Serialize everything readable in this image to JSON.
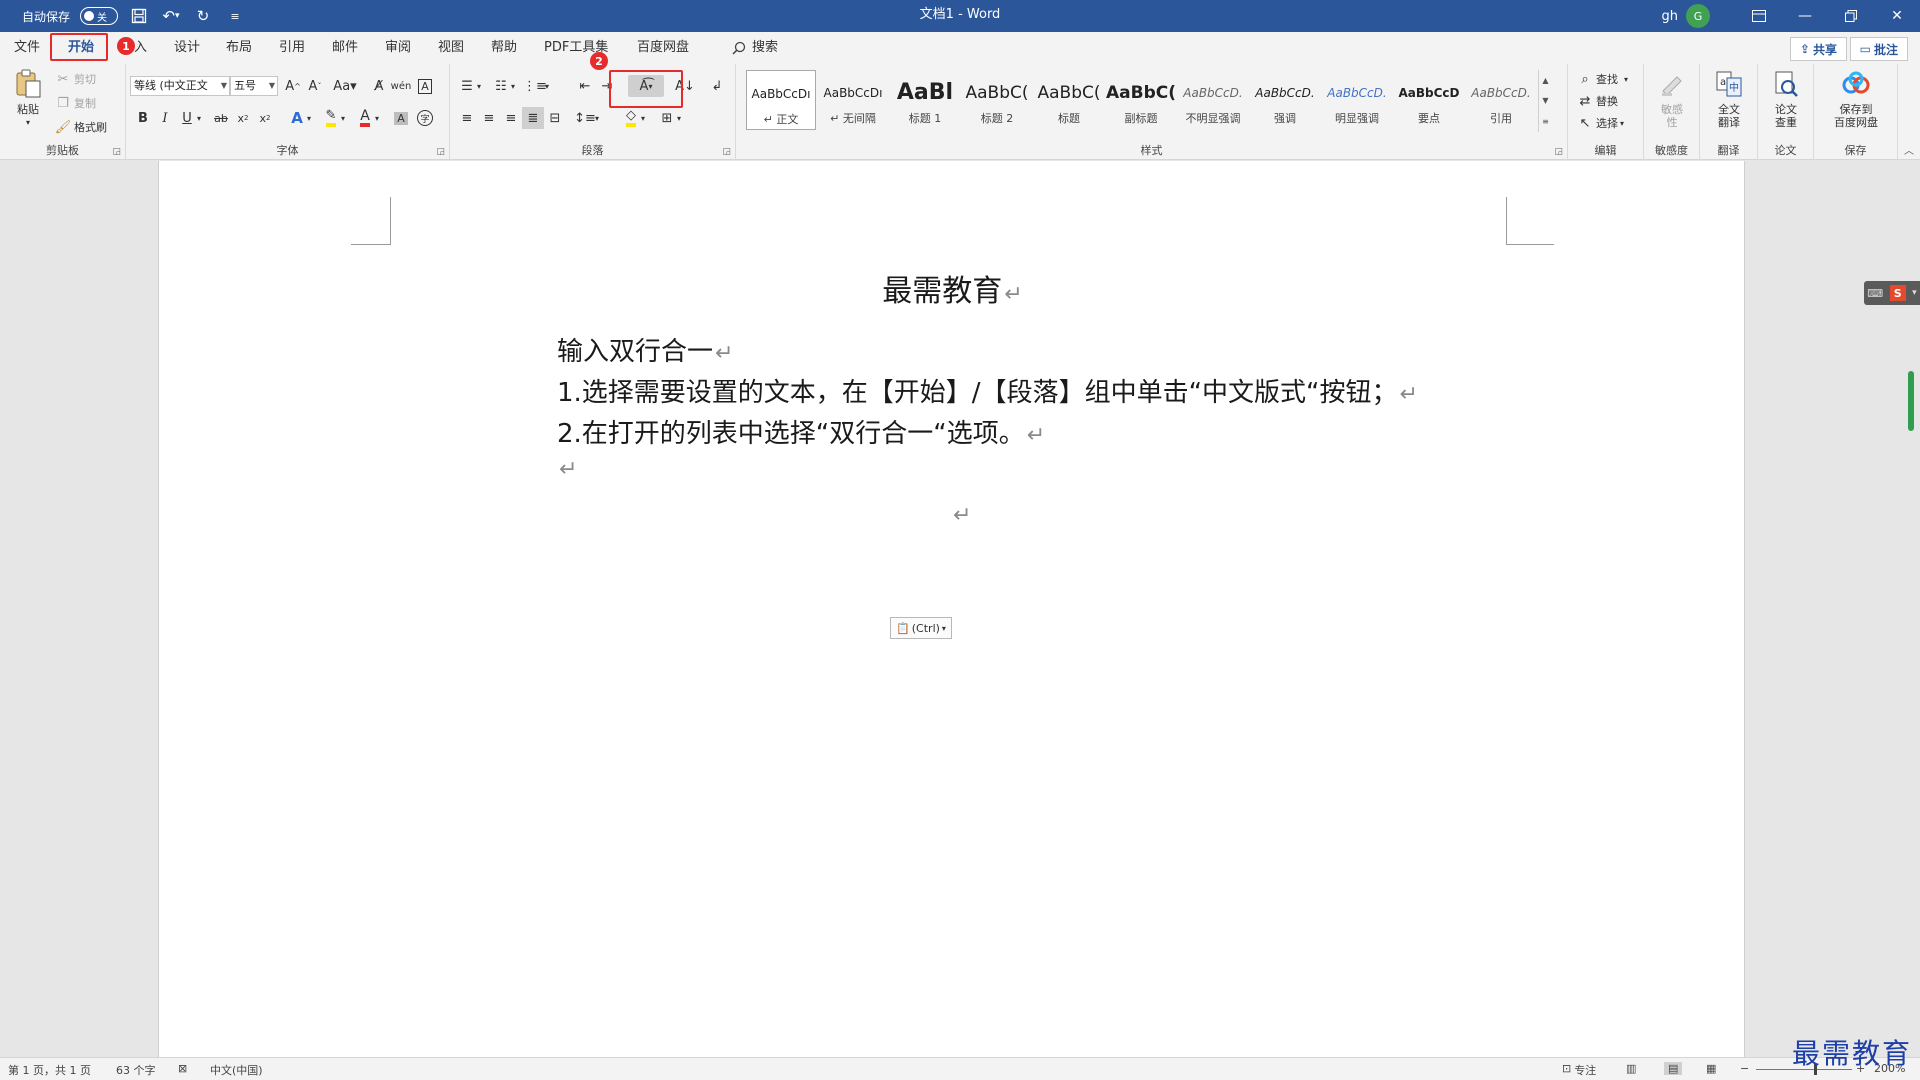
{
  "titlebar": {
    "autosave_label": "自动保存",
    "autosave_state": "关",
    "doc_title": "文档1  -  Word",
    "user_name": "gh",
    "user_initial": "G"
  },
  "tabs": [
    {
      "label": "文件"
    },
    {
      "label": "开始"
    },
    {
      "label": "入"
    },
    {
      "label": "设计"
    },
    {
      "label": "布局"
    },
    {
      "label": "引用"
    },
    {
      "label": "邮件"
    },
    {
      "label": "审阅"
    },
    {
      "label": "视图"
    },
    {
      "label": "帮助"
    },
    {
      "label": "PDF工具集"
    },
    {
      "label": "百度网盘"
    }
  ],
  "search_label": "搜索",
  "share_label": "共享",
  "comment_label": "批注",
  "badges": {
    "one": "1",
    "two": "2"
  },
  "clipboard": {
    "paste": "粘贴",
    "cut": "剪切",
    "copy": "复制",
    "format_painter": "格式刷",
    "label": "剪贴板"
  },
  "font": {
    "font_name": "等线 (中文正文",
    "font_size": "五号",
    "label": "字体"
  },
  "paragraph": {
    "label": "段落"
  },
  "styles": {
    "label": "样式",
    "items": [
      {
        "sample": "AaBbCcDı",
        "name": "↵ 正文"
      },
      {
        "sample": "AaBbCcDı",
        "name": "↵ 无间隔"
      },
      {
        "sample": "AaBl",
        "name": "标题 1"
      },
      {
        "sample": "AaBbC(",
        "name": "标题 2"
      },
      {
        "sample": "AaBbC(",
        "name": "标题"
      },
      {
        "sample": "AaBbC(",
        "name": "副标题"
      },
      {
        "sample": "AaBbCcD.",
        "name": "不明显强调"
      },
      {
        "sample": "AaBbCcD.",
        "name": "强调"
      },
      {
        "sample": "AaBbCcD.",
        "name": "明显强调"
      },
      {
        "sample": "AaBbCcD",
        "name": "要点"
      },
      {
        "sample": "AaBbCcD.",
        "name": "引用"
      }
    ]
  },
  "editing": {
    "find": "查找",
    "replace": "替换",
    "select": "选择",
    "label": "编辑"
  },
  "sensitivity": {
    "btn1": "敏感",
    "btn2": "性",
    "label": "敏感度"
  },
  "translate": {
    "btn1": "全文",
    "btn2": "翻译",
    "label": "翻译"
  },
  "paper": {
    "btn1": "论文",
    "btn2": "查重",
    "label": "论文"
  },
  "save": {
    "btn1": "保存到",
    "btn2": "百度网盘",
    "label": "保存"
  },
  "document": {
    "title": "最需教育",
    "lines": [
      "输入双行合一",
      "1.选择需要设置的文本，在【开始】/【段落】组中单击“中文版式“按钮；",
      "2.在打开的列表中选择“双行合一“选项。"
    ],
    "paste_option": "(Ctrl)"
  },
  "statusbar": {
    "page": "第 1 页，共 1 页",
    "words": "63 个字",
    "language": "中文(中国)",
    "focus": "专注",
    "zoom": "200%"
  },
  "watermark": "最需教育",
  "colors": {
    "titlebar": "#2b579a",
    "highlight": "#e52b2b"
  }
}
